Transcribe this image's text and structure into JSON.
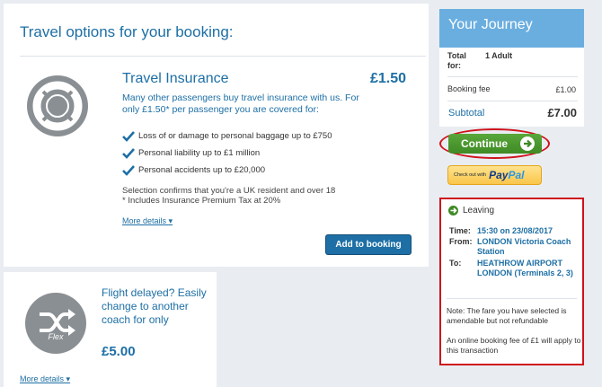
{
  "main": {
    "title": "Travel options for your booking:"
  },
  "insurance": {
    "title": "Travel Insurance",
    "price": "£1.50",
    "description": "Many other passengers buy travel insurance with us. For only £1.50* per passenger you are covered for:",
    "benefits": [
      "Loss of or damage to personal baggage up to £750",
      "Personal liability up to £1 million",
      "Personal accidents up to £20,000"
    ],
    "selection_note": "Selection confirms that you're a UK resident and over 18",
    "tax_note": "* Includes Insurance Premium Tax at 20%",
    "more_details": "More details",
    "add_button": "Add to booking",
    "icon": "lifebuoy-icon"
  },
  "flex": {
    "icon_label": "Flex",
    "text": "Flight delayed? Easily change to another coach for only",
    "price": "£5.00",
    "more_details": "More details",
    "icon": "shuffle-icon"
  },
  "journey": {
    "title": "Your Journey",
    "total_label": "Total for:",
    "total_value": "1 Adult",
    "booking_fee_label": "Booking fee",
    "booking_fee_value": "£1.00",
    "subtotal_label": "Subtotal",
    "subtotal_value": "£7.00"
  },
  "actions": {
    "continue_label": "Continue",
    "paypal_prefix": "Check out with",
    "paypal_pay": "Pay",
    "paypal_pal": "Pal"
  },
  "leaving": {
    "heading": "Leaving",
    "time_label": "Time:",
    "time_value": "15:30 on 23/08/2017",
    "from_label": "From:",
    "from_value": "LONDON Victoria Coach Station",
    "to_label": "To:",
    "to_value": "HEATHROW AIRPORT LONDON (Terminals 2, 3)",
    "fare_note": "Note: The fare you have selected is amendable but not refundable",
    "fee_note": "An online booking fee of £1 will apply to this transaction"
  },
  "colors": {
    "brand_blue": "#1d6fa5",
    "header_blue": "#6aaee0",
    "continue_green": "#4a9a2e",
    "highlight_red": "#d0121c"
  }
}
